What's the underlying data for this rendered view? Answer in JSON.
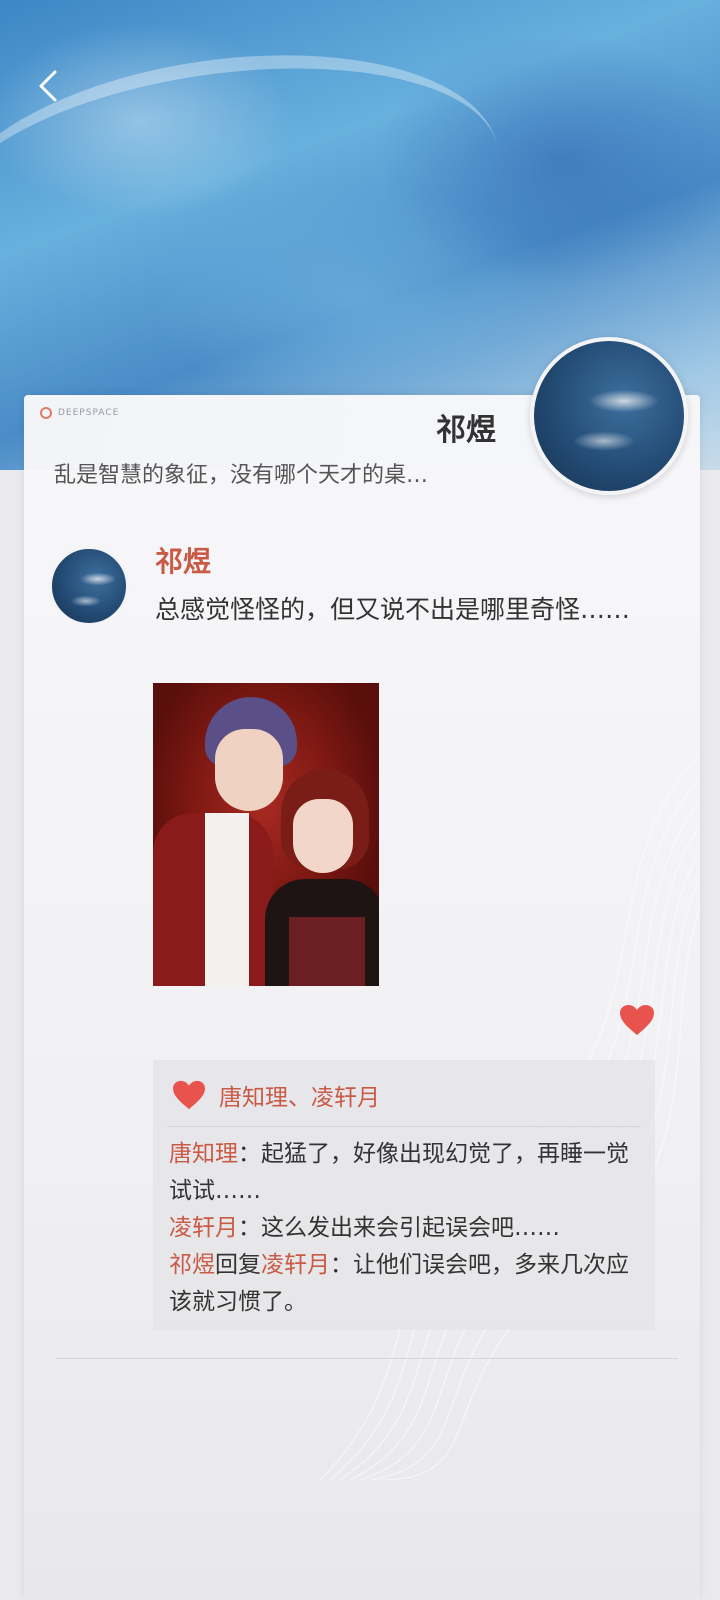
{
  "header": {
    "back_icon": "chevron-left-icon"
  },
  "profile": {
    "brand": "DEEPSPACE",
    "name": "祁煜",
    "motto": "乱是智慧的象征，没有哪个天才的桌…"
  },
  "post": {
    "author": "祁煜",
    "text": "总感觉怪怪的，但又说不出是哪里奇怪……",
    "like_icon": "heart-icon"
  },
  "comments": {
    "likes": "唐知理、凌轩月",
    "items": [
      {
        "name": "唐知理",
        "text": "：起猛了，好像出现幻觉了，再睡一觉试试……"
      },
      {
        "name": "凌轩月",
        "text": "：这么发出来会引起误会吧……"
      },
      {
        "name": "祁煜",
        "reply_word": "回复",
        "reply_to": "凌轩月",
        "text": "：让他们误会吧，多来几次应该就习惯了。"
      }
    ]
  },
  "colors": {
    "accent": "#c95a45",
    "heart": "#e9534d",
    "text": "#333333"
  }
}
